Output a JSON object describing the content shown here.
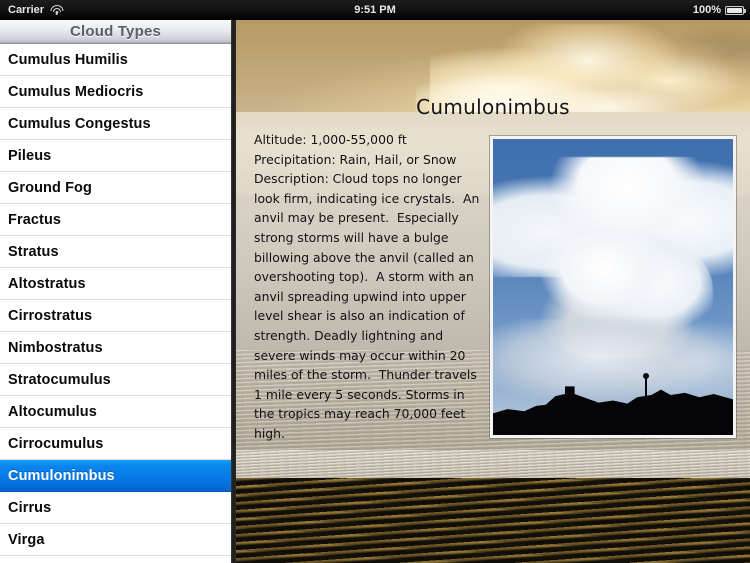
{
  "status_bar": {
    "carrier": "Carrier",
    "wifi_icon": "wifi-icon",
    "time": "9:51 PM",
    "battery_percent": "100%",
    "battery_icon": "battery-full-icon"
  },
  "master": {
    "nav_title": "Cloud Types",
    "selected_index": 13,
    "items": [
      {
        "label": "Cumulus Humilis"
      },
      {
        "label": "Cumulus Mediocris"
      },
      {
        "label": "Cumulus Congestus"
      },
      {
        "label": "Pileus"
      },
      {
        "label": "Ground Fog"
      },
      {
        "label": "Fractus"
      },
      {
        "label": "Stratus"
      },
      {
        "label": "Altostratus"
      },
      {
        "label": "Cirrostratus"
      },
      {
        "label": "Nimbostratus"
      },
      {
        "label": "Stratocumulus"
      },
      {
        "label": "Altocumulus"
      },
      {
        "label": "Cirrocumulus"
      },
      {
        "label": "Cumulonimbus"
      },
      {
        "label": "Cirrus"
      },
      {
        "label": "Virga"
      }
    ]
  },
  "detail": {
    "title": "Cumulonimbus",
    "altitude_line": "Altitude: 1,000-55,000 ft",
    "precipitation_line": "Precipitation: Rain, Hail, or Snow",
    "description_line": "Description: Cloud tops no longer look firm, indicating ice crystals.  An anvil may be present.  Especially strong storms will have a bulge billowing above the anvil (called an overshooting top).  A storm with an anvil spreading upwind into upper level shear is also an indication of strength. Deadly lightning and severe winds may occur within 20 miles of the storm.  Thunder travels 1 mile every 5 seconds. Storms in the tropics may reach 70,000 feet high.",
    "photo_alt": "cumulonimbus-cloud-photo"
  },
  "colors": {
    "selection_blue": "#0b87ee",
    "navbar_text": "#5a5f6b",
    "sky_gold": "#bda371",
    "sea_dark": "#0e0b05",
    "photo_sky_blue": "#4a79b4"
  }
}
